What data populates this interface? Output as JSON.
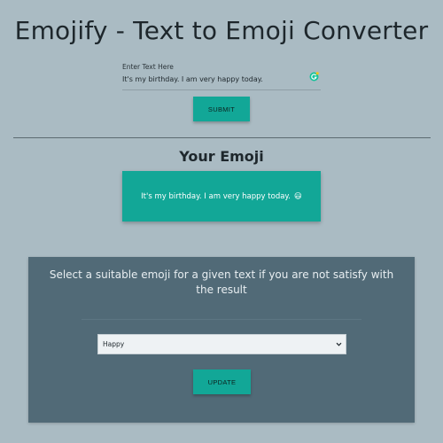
{
  "header": {
    "title": "Emojify - Text to Emoji Converter"
  },
  "input": {
    "label": "Enter Text Here",
    "value": "It's my birthday. I am very happy today."
  },
  "submit": {
    "label": "SUBMIT"
  },
  "result": {
    "heading": "Your Emoji",
    "text": "It's my birthday. I am very happy today.",
    "emoji": "😃"
  },
  "correction": {
    "prompt": "Select a suitable emoji for a given text if you are not satisfy with the result",
    "selected_option": "Happy",
    "update_label": "UPDATE"
  },
  "colors": {
    "background": "#aabbc3",
    "accent": "#12a797",
    "panel": "#516a77"
  }
}
